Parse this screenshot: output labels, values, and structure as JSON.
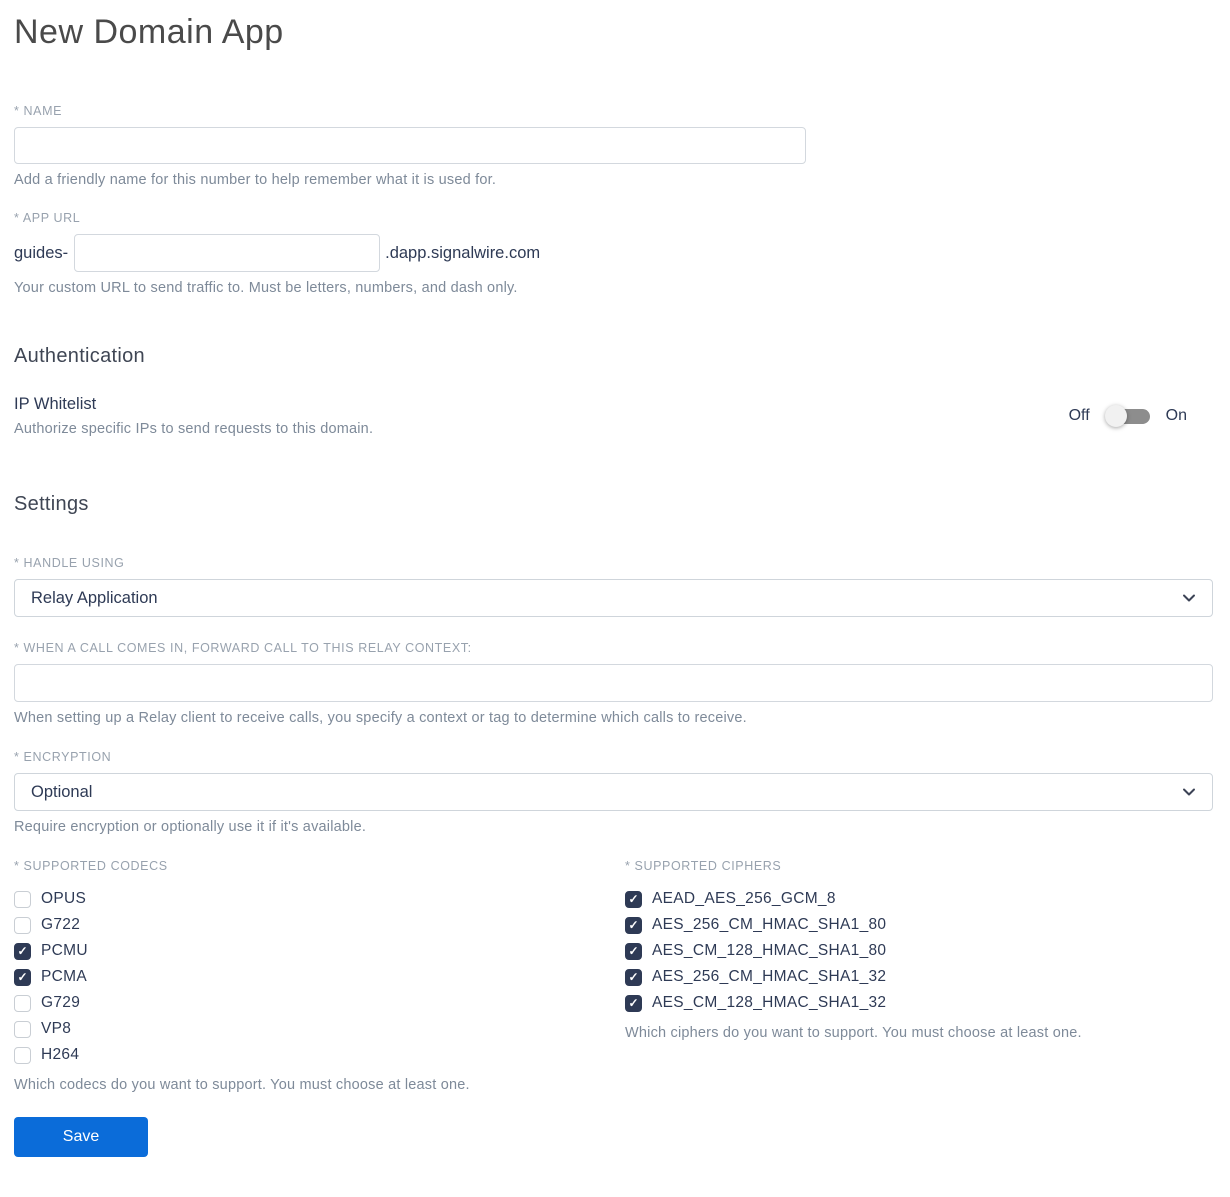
{
  "page": {
    "title": "New Domain App"
  },
  "colors": {
    "accent_blue": "#0b6cd9",
    "checkbox_navy": "#2e3a55",
    "label_gray": "#98a2ae",
    "help_gray": "#7e8a99"
  },
  "name_field": {
    "label": "* NAME",
    "value": "",
    "help": "Add a friendly name for this number to help remember what it is used for."
  },
  "app_url": {
    "label": "* APP URL",
    "prefix": "guides-",
    "value": "",
    "suffix": ".dapp.signalwire.com",
    "help": "Your custom URL to send traffic to. Must be letters, numbers, and dash only."
  },
  "authentication": {
    "heading": "Authentication",
    "ip_whitelist": {
      "label": "IP Whitelist",
      "help": "Authorize specific IPs to send requests to this domain.",
      "off_label": "Off",
      "on_label": "On",
      "state": "off"
    }
  },
  "settings": {
    "heading": "Settings",
    "handle_using": {
      "label": "* HANDLE USING",
      "selected": "Relay Application"
    },
    "relay_context": {
      "label": "* WHEN A CALL COMES IN, FORWARD CALL TO THIS RELAY CONTEXT:",
      "value": "",
      "help": "When setting up a Relay client to receive calls, you specify a context or tag to determine which calls to receive."
    },
    "encryption": {
      "label": "* ENCRYPTION",
      "selected": "Optional",
      "help": "Require encryption or optionally use it if it's available."
    },
    "codecs": {
      "label": "* SUPPORTED CODECS",
      "help": "Which codecs do you want to support. You must choose at least one.",
      "items": [
        {
          "label": "OPUS",
          "checked": false
        },
        {
          "label": "G722",
          "checked": false
        },
        {
          "label": "PCMU",
          "checked": true
        },
        {
          "label": "PCMA",
          "checked": true
        },
        {
          "label": "G729",
          "checked": false
        },
        {
          "label": "VP8",
          "checked": false
        },
        {
          "label": "H264",
          "checked": false
        }
      ]
    },
    "ciphers": {
      "label": "* SUPPORTED CIPHERS",
      "help": "Which ciphers do you want to support. You must choose at least one.",
      "items": [
        {
          "label": "AEAD_AES_256_GCM_8",
          "checked": true
        },
        {
          "label": "AES_256_CM_HMAC_SHA1_80",
          "checked": true
        },
        {
          "label": "AES_CM_128_HMAC_SHA1_80",
          "checked": true
        },
        {
          "label": "AES_256_CM_HMAC_SHA1_32",
          "checked": true
        },
        {
          "label": "AES_CM_128_HMAC_SHA1_32",
          "checked": true
        }
      ]
    }
  },
  "actions": {
    "save_label": "Save"
  }
}
